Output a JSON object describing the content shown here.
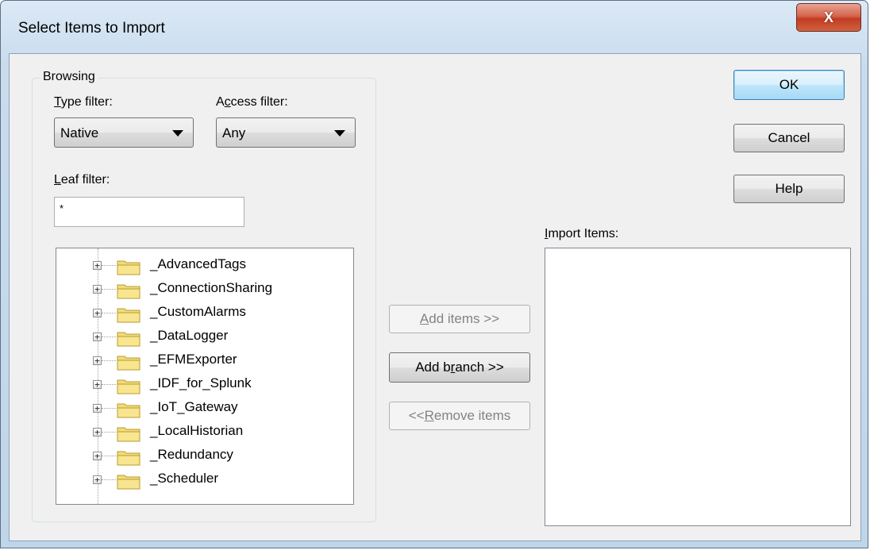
{
  "window": {
    "title": "Select Items to Import",
    "close_label": "X"
  },
  "browsing": {
    "group_label": "Browsing",
    "type_filter": {
      "label_hot": "T",
      "label_rest": "ype filter:",
      "value": "Native"
    },
    "access_filter": {
      "label_pre": "A",
      "label_hot": "c",
      "label_rest": "cess filter:",
      "value": "Any"
    },
    "leaf_filter": {
      "label_hot": "L",
      "label_rest": "eaf filter:",
      "value": "*"
    },
    "tree_items": [
      "_AdvancedTags",
      "_ConnectionSharing",
      "_CustomAlarms",
      "_DataLogger",
      "_EFMExporter",
      "_IDF_for_Splunk",
      "_IoT_Gateway",
      "_LocalHistorian",
      "_Redundancy",
      "_Scheduler"
    ]
  },
  "actions": {
    "add_items": {
      "hot": "A",
      "rest": "dd items >>"
    },
    "add_branch": {
      "pre": "Add b",
      "hot": "r",
      "rest": "anch >>"
    },
    "remove_items": {
      "pre": "<< ",
      "hot": "R",
      "rest": "emove items"
    }
  },
  "import": {
    "label_hot": "I",
    "label_rest": "mport Items:"
  },
  "buttons": {
    "ok": "OK",
    "cancel": "Cancel",
    "help": "Help"
  },
  "colors": {
    "folder_fill": "#f2dc7a",
    "folder_stroke": "#b89b2e",
    "close_red": "#c23b22"
  }
}
